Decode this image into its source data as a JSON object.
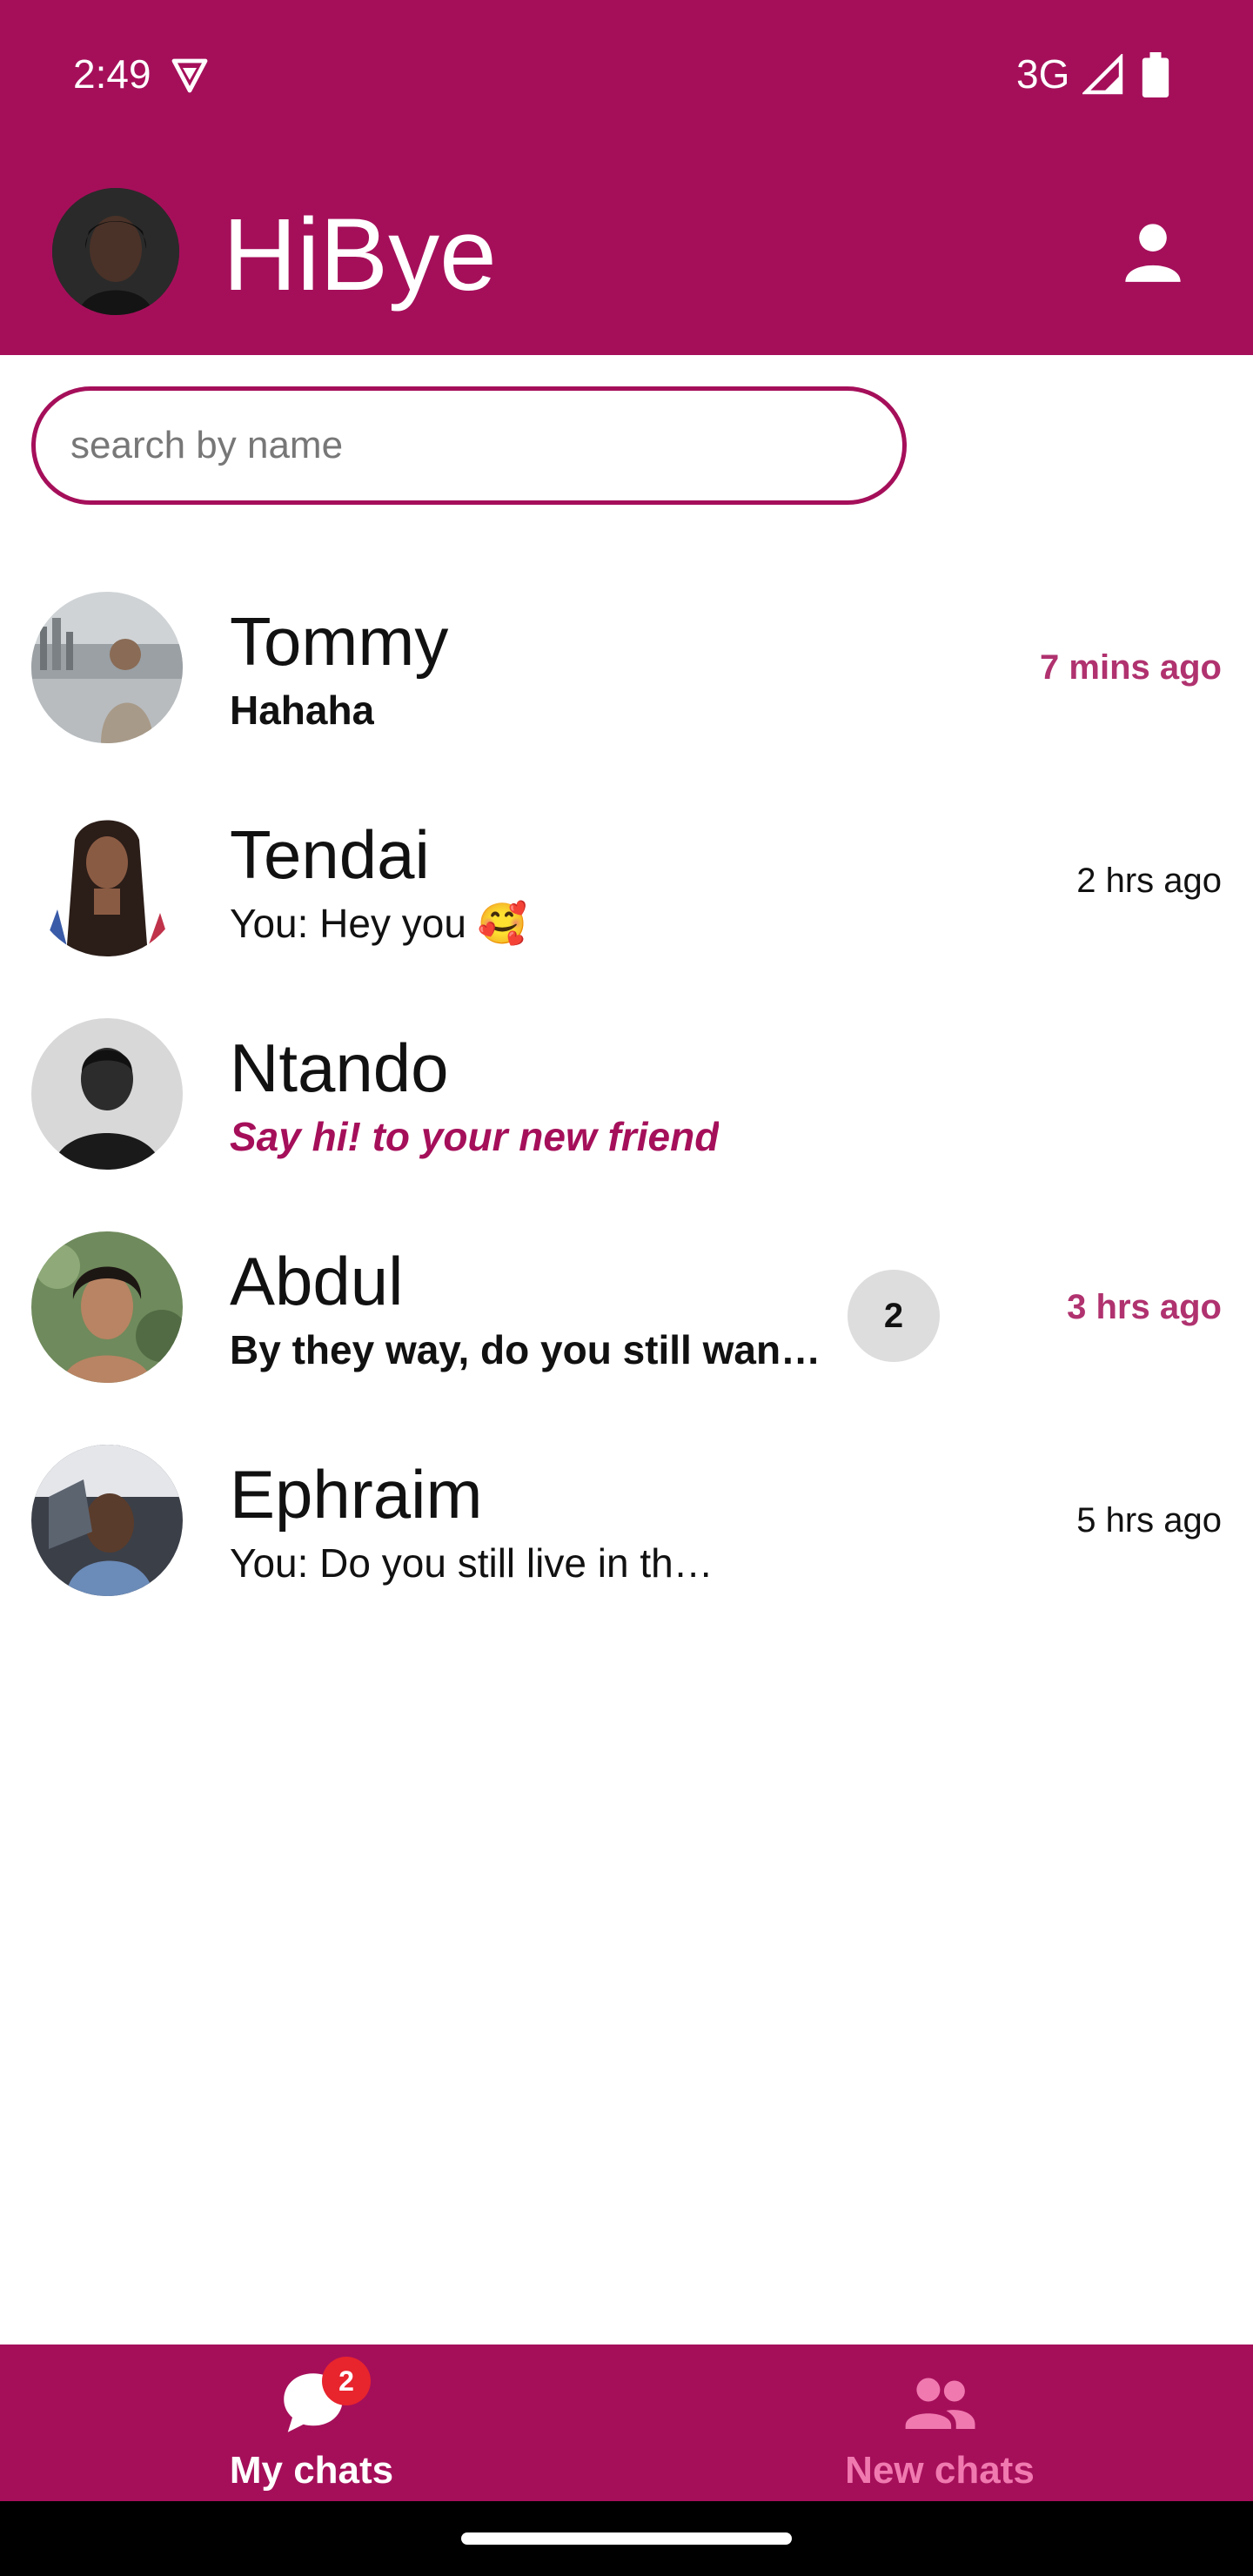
{
  "status_bar": {
    "time": "2:49",
    "network": "3G",
    "icons": [
      "vpn-shield-icon",
      "signal-icon",
      "battery-icon"
    ]
  },
  "app_bar": {
    "title": "HiBye",
    "icons": [
      "user-avatar",
      "profile-icon"
    ]
  },
  "search": {
    "placeholder": "search by name",
    "value": ""
  },
  "chats": [
    {
      "name": "Tommy",
      "message": "Hahaha",
      "time": "7 mins ago",
      "unread": true,
      "unread_count": null
    },
    {
      "name": "Tendai",
      "message": "You: Hey you 🥰",
      "time": "2 hrs ago",
      "unread": false,
      "unread_count": null
    },
    {
      "name": "Ntando",
      "message": "Say hi! to your new friend",
      "time": "",
      "unread": false,
      "unread_count": null
    },
    {
      "name": "Abdul",
      "message": "By they way, do you still wann…",
      "time": "3 hrs ago",
      "unread": true,
      "unread_count": "2"
    },
    {
      "name": "Ephraim",
      "message": "You: Do you still live in th…",
      "time": "5 hrs ago",
      "unread": false,
      "unread_count": null
    }
  ],
  "bottom_nav": {
    "my_chats": {
      "label": "My chats",
      "badge": "2",
      "icon": "chat-bubble-icon"
    },
    "new_chats": {
      "label": "New chats",
      "icon": "people-icon"
    }
  },
  "colors": {
    "brand": "#a50f5a",
    "unread_time": "#b0326f",
    "inactive_nav": "#f07ab0",
    "badge": "#e8242d"
  }
}
